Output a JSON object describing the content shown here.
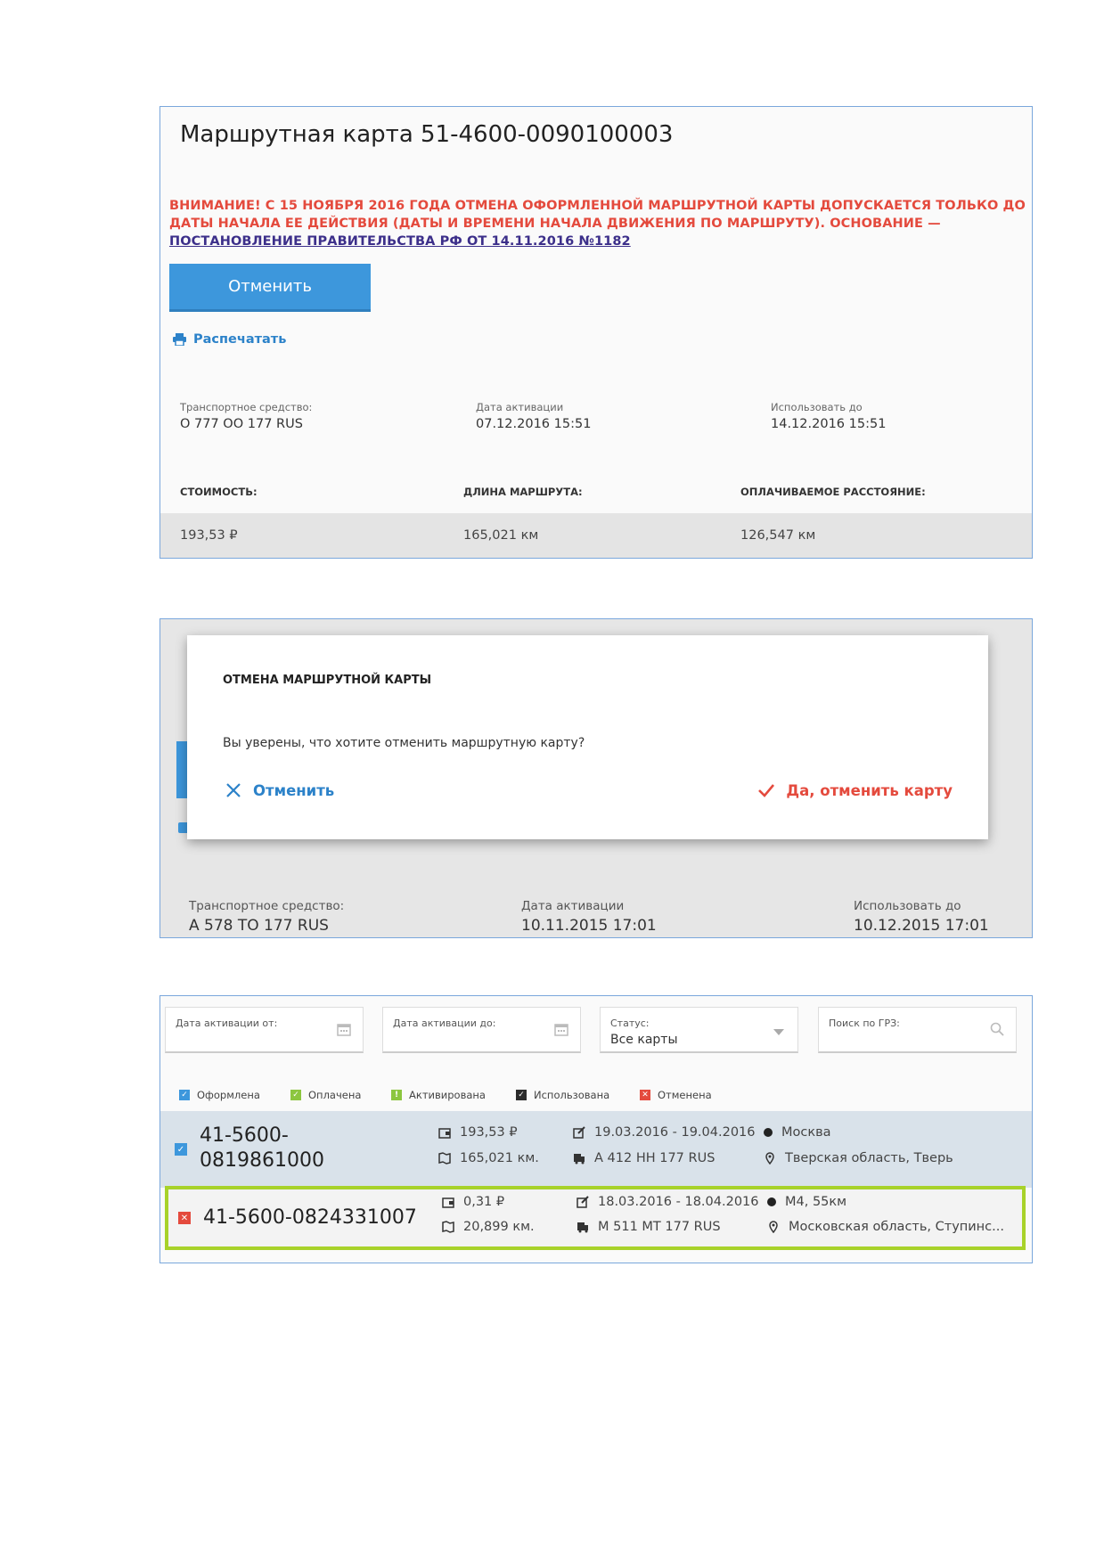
{
  "panel1": {
    "title": "Маршрутная карта 51-4600-0090100003",
    "warning_text": "ВНИМАНИЕ! С 15 НОЯБРЯ 2016 ГОДА ОТМЕНА ОФОРМЛЕННОЙ МАРШРУТНОЙ КАРТЫ ДОПУСКАЕТСЯ ТОЛЬКО ДО ДАТЫ НАЧАЛА ЕЕ ДЕЙСТВИЯ (ДАТЫ И ВРЕМЕНИ НАЧАЛА ДВИЖЕНИЯ ПО МАРШРУТУ). ОСНОВАНИЕ — ",
    "warning_link": "ПОСТАНОВЛЕНИЕ ПРАВИТЕЛЬСТВА РФ ОТ 14.11.2016 №1182",
    "cancel_button": "Отменить",
    "print_link": "Распечатать",
    "vehicle_label": "Транспортное средство:",
    "vehicle_value": "О 777 ОО 177 RUS",
    "activation_label": "Дата активации",
    "activation_value": "07.12.2016 15:51",
    "valid_label": "Использовать до",
    "valid_value": "14.12.2016 15:51",
    "cost_header": "СТОИМОСТЬ:",
    "length_header": "ДЛИНА МАРШРУТА:",
    "paid_header": "ОПЛАЧИВАЕМОЕ РАССТОЯНИЕ:",
    "cost_value": "193,53 ₽",
    "length_value": "165,021 км",
    "paid_value": "126,547 км"
  },
  "panel2": {
    "dialog_title": "ОТМЕНА МАРШРУТНОЙ КАРТЫ",
    "dialog_text": "Вы уверены, что хотите отменить маршрутную карту?",
    "cancel_label": "Отменить",
    "confirm_label": "Да, отменить карту",
    "vehicle_label": "Транспортное средство:",
    "vehicle_value": "А 578 ТО 177 RUS",
    "activation_label": "Дата активации",
    "activation_value": "10.11.2015 17:01",
    "valid_label": "Использовать до",
    "valid_value": "10.12.2015 17:01"
  },
  "panel3": {
    "filters": {
      "from_label": "Дата активации от:",
      "to_label": "Дата активации до:",
      "status_label": "Статус:",
      "status_value": "Все карты",
      "search_label": "Поиск по ГРЗ:"
    },
    "legend": [
      "Оформлена",
      "Оплачена",
      "Активирована",
      "Использована",
      "Отменена"
    ],
    "legend_colors": [
      "#3d97dc",
      "#8cc63f",
      "#8cc63f",
      "#2b2b2b",
      "#e44a3d"
    ],
    "rows": [
      {
        "id_line1": "41-5600-",
        "id_line2": "0819861000",
        "cost": "193,53 ₽",
        "distance": "165,021 км.",
        "dates": "19.03.2016 - 19.04.2016",
        "plate": "А 412 НН 177 RUS",
        "from": "Москва",
        "to": "Тверская область, Тверь"
      },
      {
        "id": "41-5600-0824331007",
        "cost": "0,31 ₽",
        "distance": "20,899 км.",
        "dates": "18.03.2016 - 18.04.2016",
        "plate": "М 511 МТ 177 RUS",
        "from": "М4, 55км",
        "to": "Московская область, Ступинс..."
      }
    ]
  }
}
